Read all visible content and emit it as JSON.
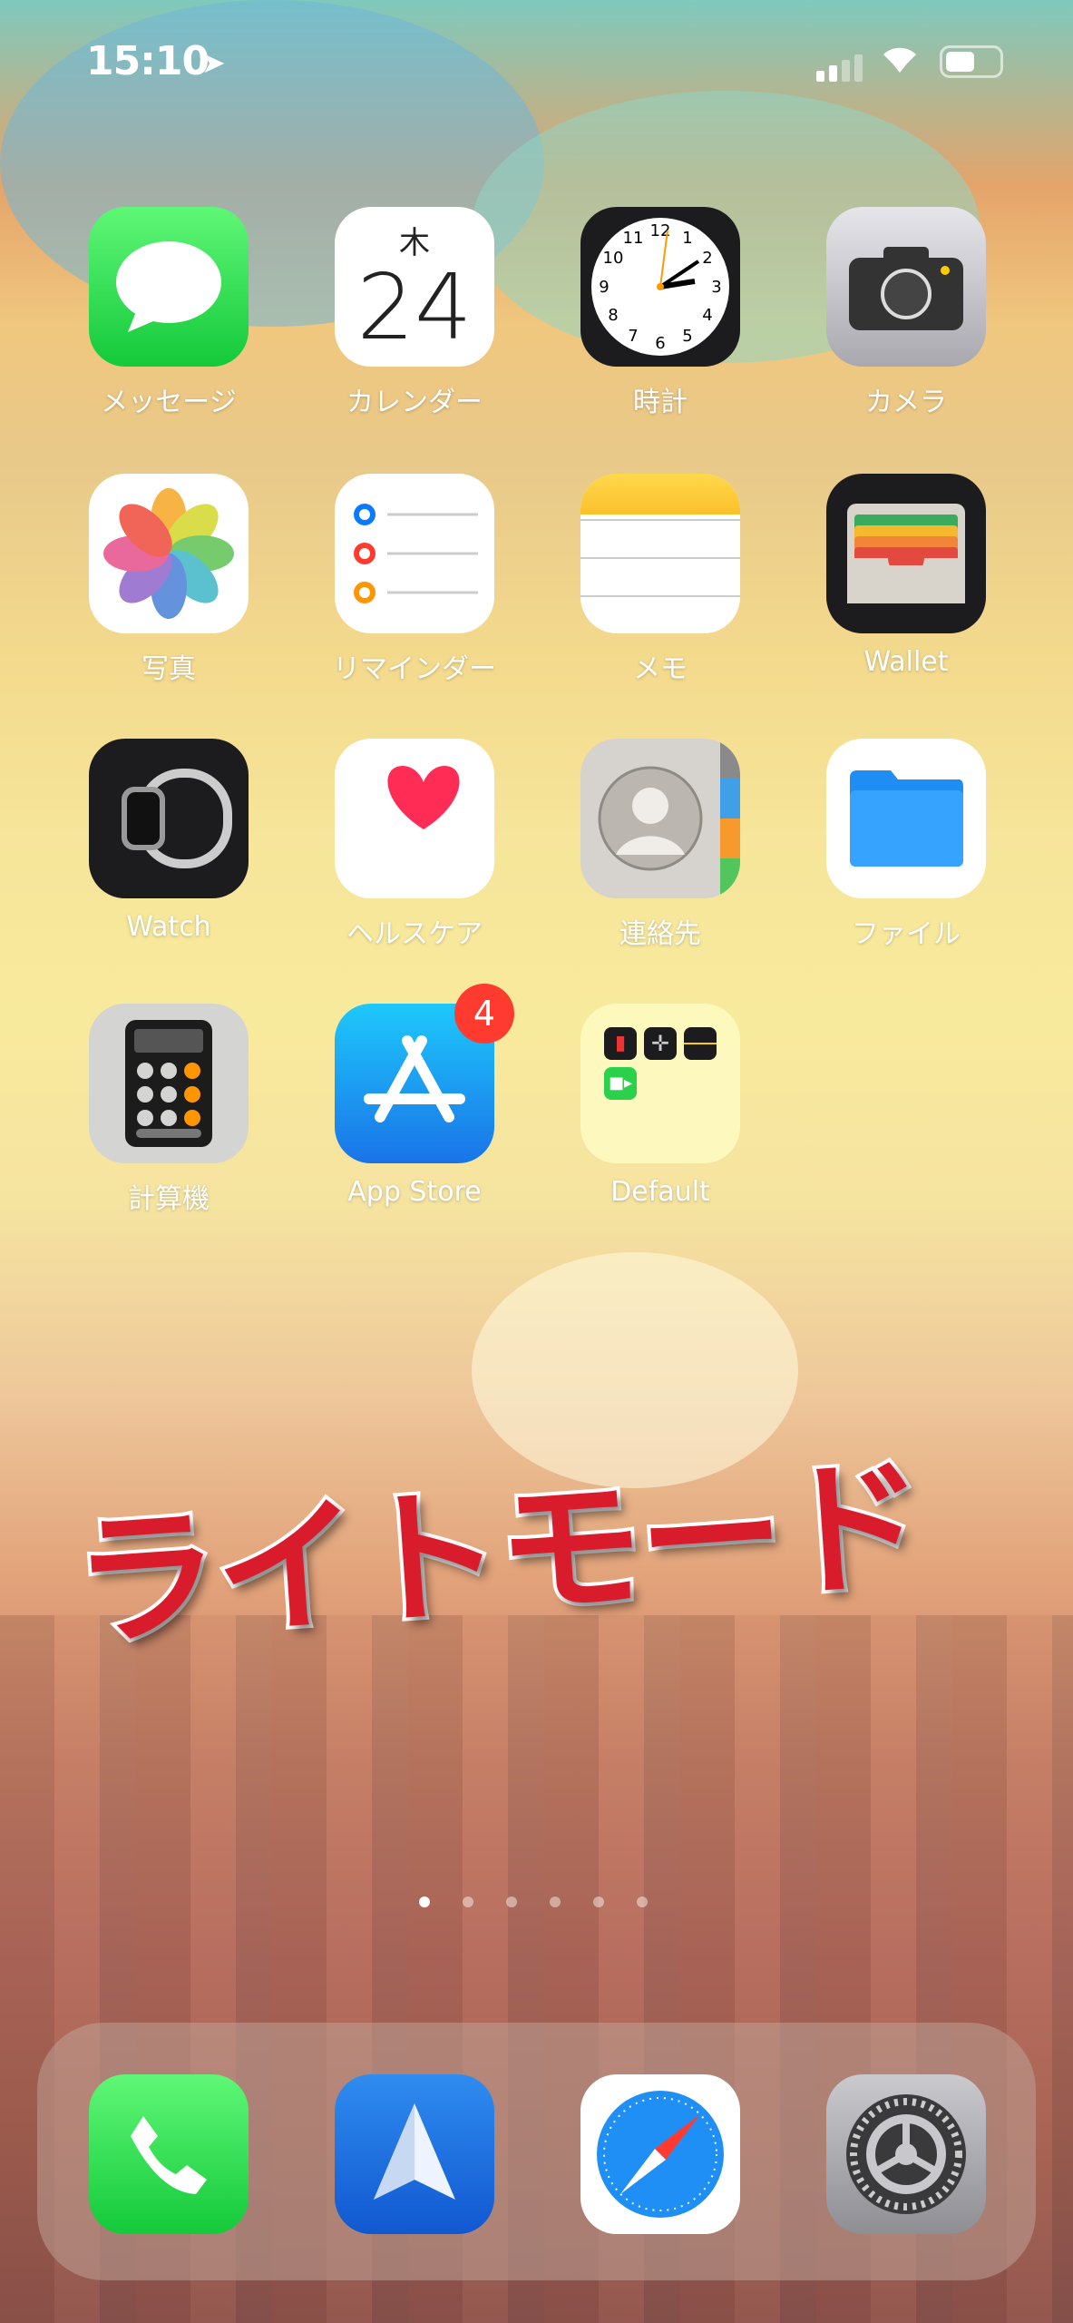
{
  "status_bar": {
    "time": "15:10",
    "location_icon": "location-arrow-icon",
    "signal_bars": 2,
    "wifi": "wifi-icon",
    "battery_level": 0.55
  },
  "apps": [
    {
      "label": "メッセージ",
      "icon": "messages-icon"
    },
    {
      "label": "カレンダー",
      "icon": "calendar-icon",
      "weekday": "木",
      "day": "24"
    },
    {
      "label": "時計",
      "icon": "clock-icon"
    },
    {
      "label": "カメラ",
      "icon": "camera-icon"
    },
    {
      "label": "写真",
      "icon": "photos-icon"
    },
    {
      "label": "リマインダー",
      "icon": "reminders-icon"
    },
    {
      "label": "メモ",
      "icon": "notes-icon"
    },
    {
      "label": "Wallet",
      "icon": "wallet-icon"
    },
    {
      "label": "Watch",
      "icon": "watch-icon"
    },
    {
      "label": "ヘルスケア",
      "icon": "health-icon"
    },
    {
      "label": "連絡先",
      "icon": "contacts-icon"
    },
    {
      "label": "ファイル",
      "icon": "files-icon"
    },
    {
      "label": "計算機",
      "icon": "calculator-icon"
    },
    {
      "label": "App Store",
      "icon": "app-store-icon",
      "badge": "4"
    },
    {
      "label": "Default",
      "icon": "folder-icon"
    }
  ],
  "overlay_text": "ライトモード",
  "page_dots": {
    "count": 6,
    "active": 1
  },
  "dock": [
    {
      "icon": "phone-icon"
    },
    {
      "icon": "spark-mail-icon"
    },
    {
      "icon": "safari-icon"
    },
    {
      "icon": "settings-icon"
    }
  ],
  "colors": {
    "badge": "#ff3b30",
    "overlay_text": "#d91c2b"
  }
}
